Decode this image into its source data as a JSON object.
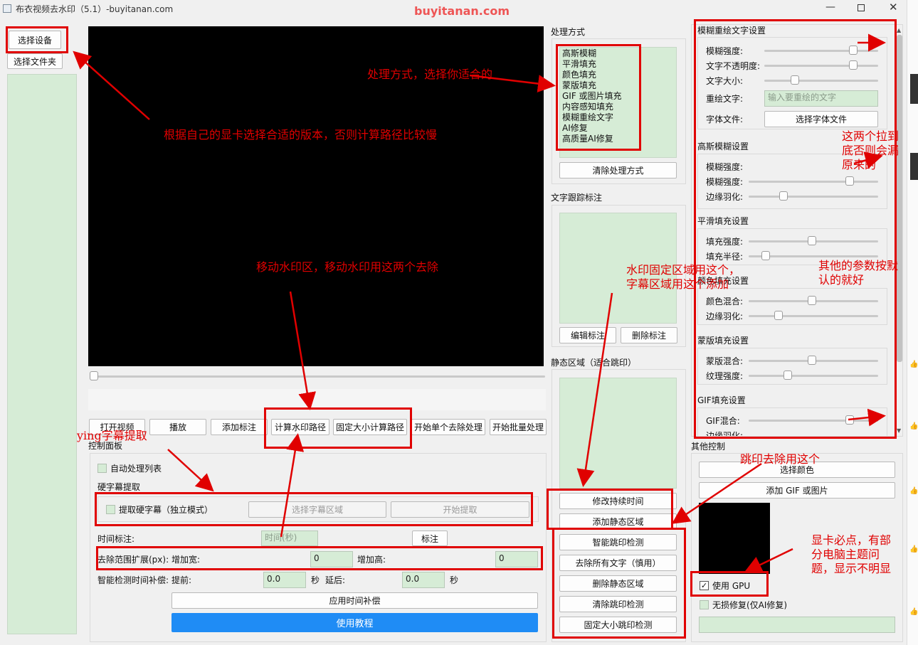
{
  "window": {
    "title": "布衣视频去水印（5.1）-buyitanan.com",
    "watermark": "buyitanan.com"
  },
  "left": {
    "select_device": "选择设备",
    "select_folder": "选择文件夹"
  },
  "toolbar": {
    "open_video": "打开视频",
    "play": "播放",
    "add_mark": "添加标注",
    "calc_path": "计算水印路径",
    "fixed_calc_path": "固定大小计算路径",
    "single_remove": "开始单个去除处理",
    "batch_remove": "开始批量处理"
  },
  "control": {
    "title": "控制面板",
    "auto_process": "自动处理列表",
    "hard_sub_title": "硬字幕提取",
    "extract_hard_sub": "提取硬字幕（独立模式）",
    "select_sub_area": "选择字幕区域",
    "start_extract": "开始提取",
    "time_mark_label": "时间标注:",
    "time_placeholder": "时间(秒)",
    "mark_button": "标注",
    "expand_label": "去除范围扩展(px):",
    "add_width_label": "增加宽:",
    "add_width_value": "0",
    "add_height_label": "增加高:",
    "add_height_value": "0",
    "comp_label": "智能检测时间补偿:",
    "before_label": "提前:",
    "before_value": "0.0",
    "sec1": "秒",
    "after_label": "延后:",
    "after_value": "0.0",
    "sec2": "秒",
    "apply_comp": "应用时间补偿",
    "tutorial": "使用教程"
  },
  "methods": {
    "title": "处理方式",
    "items": [
      "高斯模糊",
      "平滑填充",
      "颜色填充",
      "蒙版填充",
      "GIF 或图片填充",
      "内容感知填充",
      "模糊重绘文字",
      "AI修复",
      "高质量AI修复"
    ],
    "clear": "清除处理方式"
  },
  "tracking": {
    "title": "文字跟踪标注",
    "edit": "编辑标注",
    "delete": "删除标注"
  },
  "static_area": {
    "title": "静态区域（适合跳印）",
    "modify_duration": "修改持续时间",
    "add_static": "添加静态区域",
    "smart_jump": "智能跳印检测",
    "remove_all_text": "去除所有文字（慎用）",
    "delete_static": "删除静态区域",
    "clear_jump": "清除跳印检测",
    "fixed_jump": "固定大小跳印检测"
  },
  "settings": {
    "blur_redraw": {
      "title": "模糊重绘文字设置",
      "blur_strength": "模糊强度:",
      "text_opacity": "文字不透明度:",
      "text_size": "文字大小:",
      "redraw_text": "重绘文字:",
      "redraw_placeholder": "输入要重绘的文字",
      "font_file": "字体文件:",
      "select_font": "选择字体文件",
      "levels": {
        "blur_strength": 0.78,
        "text_opacity": 0.78,
        "text_size": 0.27
      }
    },
    "gauss": {
      "title": "高斯模糊设置",
      "blur_strength_1": "模糊强度:",
      "blur_strength_2": "模糊强度:",
      "feather": "边缘羽化:",
      "levels": {
        "blur_strength_2": 0.78,
        "feather": 0.27
      }
    },
    "smooth": {
      "title": "平滑填充设置",
      "fill_strength": "填充强度:",
      "fill_radius": "填充半径:",
      "levels": {
        "fill_strength": 0.49,
        "fill_radius": 0.13
      }
    },
    "color": {
      "title": "颜色填充设置",
      "color_mix": "颜色混合:",
      "feather": "边缘羽化:",
      "levels": {
        "color_mix": 0.49,
        "feather": 0.23
      }
    },
    "mask": {
      "title": "蒙版填充设置",
      "mask_mix": "蒙版混合:",
      "texture": "纹理强度:",
      "levels": {
        "mask_mix": 0.49,
        "texture": 0.3
      }
    },
    "gif": {
      "title": "GIF填充设置",
      "gif_mix": "GIF混合:",
      "feather": "边缘羽化:",
      "levels": {
        "gif_mix": 0.78
      }
    }
  },
  "other": {
    "title": "其他控制",
    "select_color": "选择颜色",
    "add_gif": "添加 GIF 或图片",
    "use_gpu": "使用 GPU",
    "lossless": "无损修复(仅AI修复)"
  },
  "annotations": {
    "method_note": "处理方式，选择你适合的",
    "device_note": "根据自己的显卡选择合适的版本，否则计算路径比较慢",
    "slider_note_1": "这两个拉到",
    "slider_note_2": "底否则会漏",
    "slider_note_3": "原来的",
    "moving_note": "移动水印区，移动水印用这两个去除",
    "fixed_note_1": "水印固定区域用这个，",
    "fixed_note_2": "字幕区域用这个添加",
    "default_note_1": "其他的参数按默",
    "default_note_2": "认的就好",
    "sub_note": "ying字幕提取",
    "jump_note": "跳印去除用这个",
    "gpu_note_1": "显卡必点，有部",
    "gpu_note_2": "分电脑主题问",
    "gpu_note_3": "题，显示不明显"
  }
}
